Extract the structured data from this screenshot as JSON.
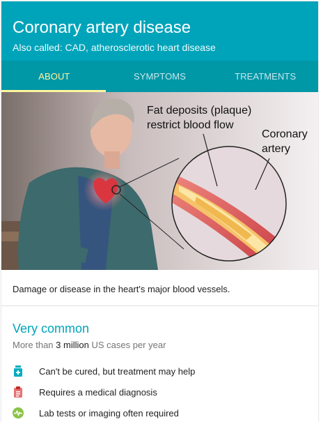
{
  "header": {
    "title": "Coronary artery disease",
    "subtitle": "Also called: CAD, atherosclerotic heart disease",
    "background_color": "#00a4ba"
  },
  "tabs": [
    {
      "label": "ABOUT",
      "active": true
    },
    {
      "label": "SYMPTOMS",
      "active": false
    },
    {
      "label": "TREATMENTS",
      "active": false
    }
  ],
  "illustration": {
    "label_plaque_line1": "Fat deposits (plaque)",
    "label_plaque_line2": "restrict blood flow",
    "label_artery_line1": "Coronary",
    "label_artery_line2": "artery"
  },
  "description": "Damage or disease in the heart's major blood vessels.",
  "frequency": {
    "title": "Very common",
    "prefix": "More than",
    "count": "3 million",
    "suffix": "US cases per year"
  },
  "facts": [
    {
      "icon": "medicine-bottle-icon",
      "text": "Can't be cured, but treatment may help",
      "color": "#00acc1"
    },
    {
      "icon": "clipboard-icon",
      "text": "Requires a medical diagnosis",
      "color": "#e57373"
    },
    {
      "icon": "heartbeat-icon",
      "text": "Lab tests or imaging often required",
      "color": "#8bc34a"
    }
  ]
}
